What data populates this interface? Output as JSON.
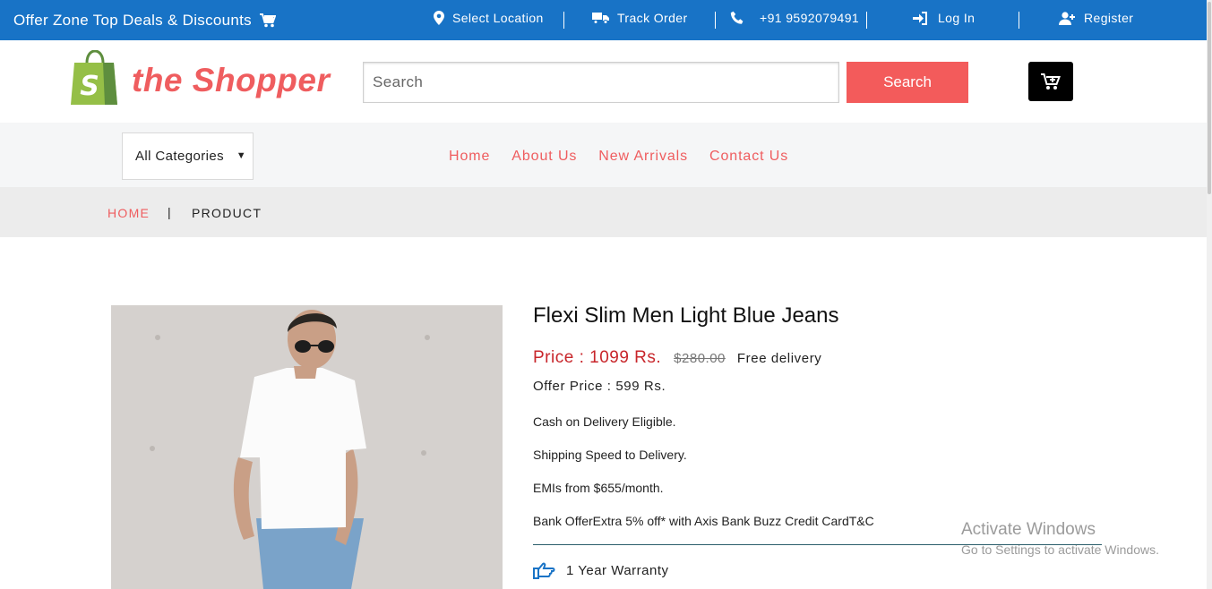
{
  "topbar": {
    "offer_text": "Offer Zone Top Deals & Discounts",
    "select_location": "Select Location",
    "track_order": "Track Order",
    "phone": "+91 9592079491",
    "login": "Log In",
    "register": "Register"
  },
  "header": {
    "brand_name": "the Shopper",
    "search_placeholder": "Search",
    "search_button": "Search"
  },
  "nav": {
    "category_select": "All Categories",
    "menu": [
      "Home",
      "About Us",
      "New Arrivals",
      "Contact Us"
    ]
  },
  "breadcrumb": {
    "home": "HOME",
    "separator": "|",
    "current": "PRODUCT"
  },
  "product": {
    "title": "Flexi Slim Men Light Blue Jeans",
    "price": "Price : 1099 Rs.",
    "old_price": "$280.00",
    "delivery": "Free delivery",
    "offer_price": "Offer Price : 599 Rs.",
    "features": [
      "Cash on Delivery Eligible.",
      "Shipping Speed to Delivery.",
      "EMIs from $655/month.",
      "Bank OfferExtra 5% off* with Axis Bank Buzz Credit CardT&C"
    ],
    "warranty": "1 Year Warranty"
  },
  "watermark": {
    "line1": "Activate Windows",
    "line2": "Go to Settings to activate Windows."
  },
  "colors": {
    "topbar": "#1873c6",
    "accent": "#ef5d5f",
    "search_button": "#f35b5b",
    "price": "#c8262b"
  }
}
